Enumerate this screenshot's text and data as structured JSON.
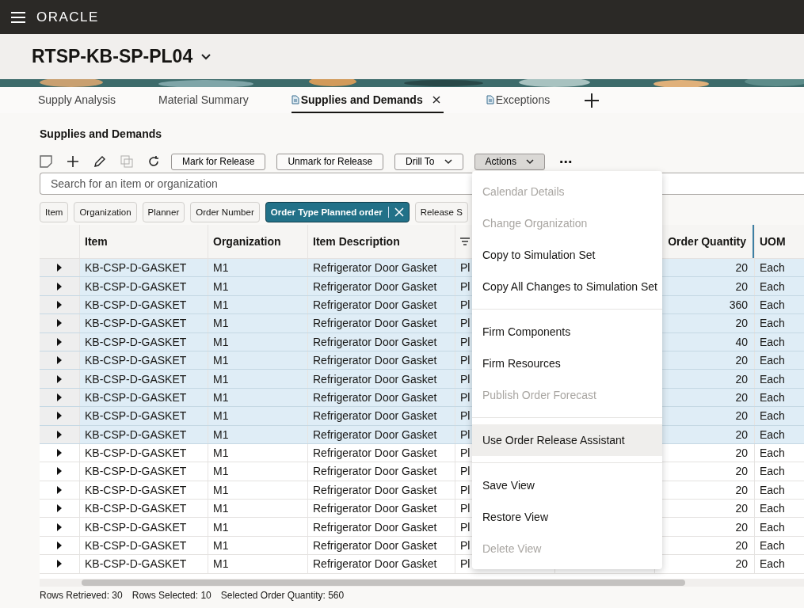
{
  "header": {
    "logo": "ORACLE"
  },
  "page_title": "RTSP-KB-SP-PL04",
  "tabs": [
    {
      "label": "Supply Analysis",
      "selected": false,
      "doc_icon": false,
      "closable": false
    },
    {
      "label": "Material Summary",
      "selected": false,
      "doc_icon": false,
      "closable": false
    },
    {
      "label": "Supplies and Demands",
      "selected": true,
      "doc_icon": true,
      "closable": true
    },
    {
      "label": "Exceptions",
      "selected": false,
      "doc_icon": true,
      "closable": false
    }
  ],
  "section_title": "Supplies and Demands",
  "toolbar": {
    "icons": [
      {
        "kind": "note",
        "disabled": false
      },
      {
        "kind": "add",
        "disabled": false
      },
      {
        "kind": "edit",
        "disabled": false
      },
      {
        "kind": "copy",
        "disabled": true
      },
      {
        "kind": "refresh",
        "disabled": false
      }
    ],
    "buttons": [
      {
        "label": "Mark for Release",
        "dropdown": false,
        "expanded": false
      },
      {
        "label": "Unmark for Release",
        "dropdown": false,
        "expanded": false
      },
      {
        "label": "Drill To",
        "dropdown": true,
        "expanded": false
      },
      {
        "label": "Actions",
        "dropdown": true,
        "expanded": true
      }
    ],
    "more": "⋯"
  },
  "search": {
    "placeholder": "Search for an item or organization"
  },
  "filter_chips": [
    {
      "label": "Item",
      "selected": false
    },
    {
      "label": "Organization",
      "selected": false
    },
    {
      "label": "Planner",
      "selected": false
    },
    {
      "label": "Order Number",
      "selected": false
    },
    {
      "label": "Order Type Planned order",
      "selected": true
    },
    {
      "label": "Release S",
      "selected": false
    }
  ],
  "table": {
    "columns": [
      {
        "kind": "text",
        "label": "Item"
      },
      {
        "kind": "text",
        "label": "Organization"
      },
      {
        "kind": "text",
        "label": "Item Description"
      },
      {
        "kind": "filter"
      },
      {
        "kind": "blank"
      },
      {
        "kind": "number",
        "label": "Order Quantity"
      },
      {
        "kind": "text",
        "label": "UOM"
      }
    ],
    "rows": [
      {
        "item": "KB-CSP-D-GASKET",
        "organization": "M1",
        "description": "Refrigerator Door Gasket",
        "column_4": "Pl",
        "order_quantity": "20",
        "uom": "Each",
        "selected": true
      },
      {
        "item": "KB-CSP-D-GASKET",
        "organization": "M1",
        "description": "Refrigerator Door Gasket",
        "column_4": "Pl",
        "order_quantity": "20",
        "uom": "Each",
        "selected": true
      },
      {
        "item": "KB-CSP-D-GASKET",
        "organization": "M1",
        "description": "Refrigerator Door Gasket",
        "column_4": "Pl",
        "order_quantity": "360",
        "uom": "Each",
        "selected": true
      },
      {
        "item": "KB-CSP-D-GASKET",
        "organization": "M1",
        "description": "Refrigerator Door Gasket",
        "column_4": "Pl",
        "order_quantity": "20",
        "uom": "Each",
        "selected": true
      },
      {
        "item": "KB-CSP-D-GASKET",
        "organization": "M1",
        "description": "Refrigerator Door Gasket",
        "column_4": "Pl",
        "order_quantity": "40",
        "uom": "Each",
        "selected": true
      },
      {
        "item": "KB-CSP-D-GASKET",
        "organization": "M1",
        "description": "Refrigerator Door Gasket",
        "column_4": "Pl",
        "order_quantity": "20",
        "uom": "Each",
        "selected": true
      },
      {
        "item": "KB-CSP-D-GASKET",
        "organization": "M1",
        "description": "Refrigerator Door Gasket",
        "column_4": "Pl",
        "order_quantity": "20",
        "uom": "Each",
        "selected": true
      },
      {
        "item": "KB-CSP-D-GASKET",
        "organization": "M1",
        "description": "Refrigerator Door Gasket",
        "column_4": "Pl",
        "order_quantity": "20",
        "uom": "Each",
        "selected": true
      },
      {
        "item": "KB-CSP-D-GASKET",
        "organization": "M1",
        "description": "Refrigerator Door Gasket",
        "column_4": "Pl",
        "order_quantity": "20",
        "uom": "Each",
        "selected": true
      },
      {
        "item": "KB-CSP-D-GASKET",
        "organization": "M1",
        "description": "Refrigerator Door Gasket",
        "column_4": "Pl",
        "order_quantity": "20",
        "uom": "Each",
        "selected": true
      },
      {
        "item": "KB-CSP-D-GASKET",
        "organization": "M1",
        "description": "Refrigerator Door Gasket",
        "column_4": "Pl",
        "order_quantity": "20",
        "uom": "Each",
        "selected": false
      },
      {
        "item": "KB-CSP-D-GASKET",
        "organization": "M1",
        "description": "Refrigerator Door Gasket",
        "column_4": "Pl",
        "order_quantity": "20",
        "uom": "Each",
        "selected": false
      },
      {
        "item": "KB-CSP-D-GASKET",
        "organization": "M1",
        "description": "Refrigerator Door Gasket",
        "column_4": "Pl",
        "order_quantity": "20",
        "uom": "Each",
        "selected": false
      },
      {
        "item": "KB-CSP-D-GASKET",
        "organization": "M1",
        "description": "Refrigerator Door Gasket",
        "column_4": "Pl",
        "order_quantity": "20",
        "uom": "Each",
        "selected": false
      },
      {
        "item": "KB-CSP-D-GASKET",
        "organization": "M1",
        "description": "Refrigerator Door Gasket",
        "column_4": "Pl",
        "order_quantity": "20",
        "uom": "Each",
        "selected": false
      },
      {
        "item": "KB-CSP-D-GASKET",
        "organization": "M1",
        "description": "Refrigerator Door Gasket",
        "column_4": "Pl",
        "order_quantity": "20",
        "uom": "Each",
        "selected": false
      },
      {
        "item": "KB-CSP-D-GASKET",
        "organization": "M1",
        "description": "Refrigerator Door Gasket",
        "column_4": "Pl",
        "order_quantity": "20",
        "uom": "Each",
        "selected": false
      }
    ]
  },
  "actions_menu": {
    "groups": [
      [
        {
          "label": "Calendar Details",
          "disabled": true,
          "highlighted": false
        },
        {
          "label": "Change Organization",
          "disabled": true,
          "highlighted": false
        },
        {
          "label": "Copy to Simulation Set",
          "disabled": false,
          "highlighted": false
        },
        {
          "label": "Copy All Changes to Simulation Set",
          "disabled": false,
          "highlighted": false
        }
      ],
      [
        {
          "label": "Firm Components",
          "disabled": false,
          "highlighted": false
        },
        {
          "label": "Firm Resources",
          "disabled": false,
          "highlighted": false
        },
        {
          "label": "Publish Order Forecast",
          "disabled": true,
          "highlighted": false
        }
      ],
      [
        {
          "label": "Use Order Release Assistant",
          "disabled": false,
          "highlighted": true
        }
      ],
      [
        {
          "label": "Save View",
          "disabled": false,
          "highlighted": false
        },
        {
          "label": "Restore View",
          "disabled": false,
          "highlighted": false
        },
        {
          "label": "Delete View",
          "disabled": true,
          "highlighted": false
        }
      ]
    ]
  },
  "status_bar": [
    "Rows Retrieved: 30",
    "Rows Selected: 10",
    "Selected Order Quantity: 560"
  ]
}
